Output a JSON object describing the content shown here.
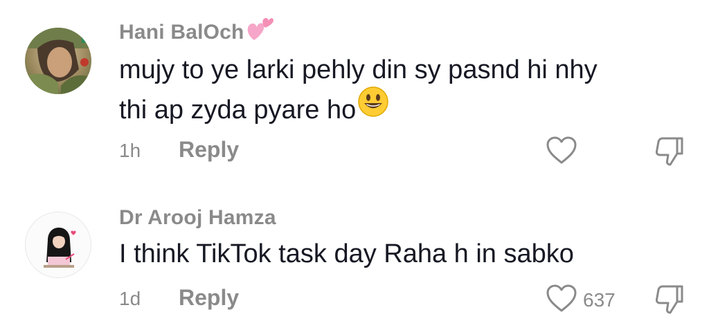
{
  "comments": [
    {
      "username": "Hani BalOch",
      "username_emoji": "pink-hearts",
      "text_line1": "mujy to ye larki pehly din sy pasnd hi nhy",
      "text_line2": "thi ap zyda pyare ho",
      "text_emoji": "grinning-face",
      "time": "1h",
      "reply_label": "Reply",
      "like_count": ""
    },
    {
      "username": "Dr Arooj Hamza",
      "text_line1": "I think TikTok task day Raha h in sabko",
      "time": "1d",
      "reply_label": "Reply",
      "like_count": "637"
    }
  ],
  "colors": {
    "username": "#8a8a8a",
    "text": "#161823",
    "meta": "#8a8a8a",
    "heart": "#f8a8c8"
  },
  "icons": {
    "like": "heart-outline-icon",
    "dislike": "thumbs-down-outline-icon"
  }
}
